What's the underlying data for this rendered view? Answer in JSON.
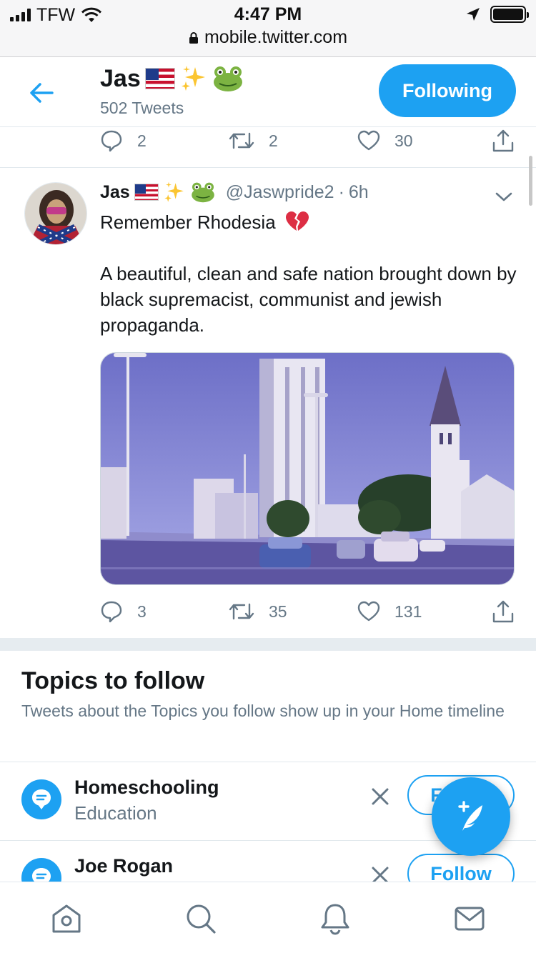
{
  "status_bar": {
    "carrier": "TFW",
    "time": "4:47 PM",
    "url": "mobile.twitter.com",
    "battery_level": 1.0
  },
  "profile_header": {
    "name": "Jas",
    "tweet_count": "502 Tweets",
    "following_label": "Following"
  },
  "previous_tweet_actions": {
    "replies": "2",
    "retweets": "2",
    "likes": "30"
  },
  "tweet": {
    "name": "Jas",
    "handle": "@Jaswpride2",
    "separator": "·",
    "time": "6h",
    "text_line1": "Remember Rhodesia",
    "text_body": "A beautiful, clean and safe nation brought down by black supremacist, communist and jewish propaganda.",
    "replies": "3",
    "retweets": "35",
    "likes": "131"
  },
  "topics": {
    "title": "Topics to follow",
    "subtitle": "Tweets about the Topics you follow show up in your Home timeline",
    "items": [
      {
        "name": "Homeschooling",
        "category": "Education",
        "follow_label": "Follow"
      },
      {
        "name": "Joe Rogan",
        "category": "",
        "follow_label": "Follow"
      }
    ]
  },
  "icons": {
    "back": "arrow-left-icon",
    "reply": "comment-icon",
    "retweet": "retweet-icon",
    "like": "heart-icon",
    "share": "share-icon",
    "compose": "compose-tweet-icon",
    "tabs": [
      "home-icon",
      "search-icon",
      "notifications-icon",
      "messages-icon"
    ]
  },
  "colors": {
    "accent": "#1da1f2",
    "muted_text": "#657786",
    "divider": "#e6ecf0"
  }
}
